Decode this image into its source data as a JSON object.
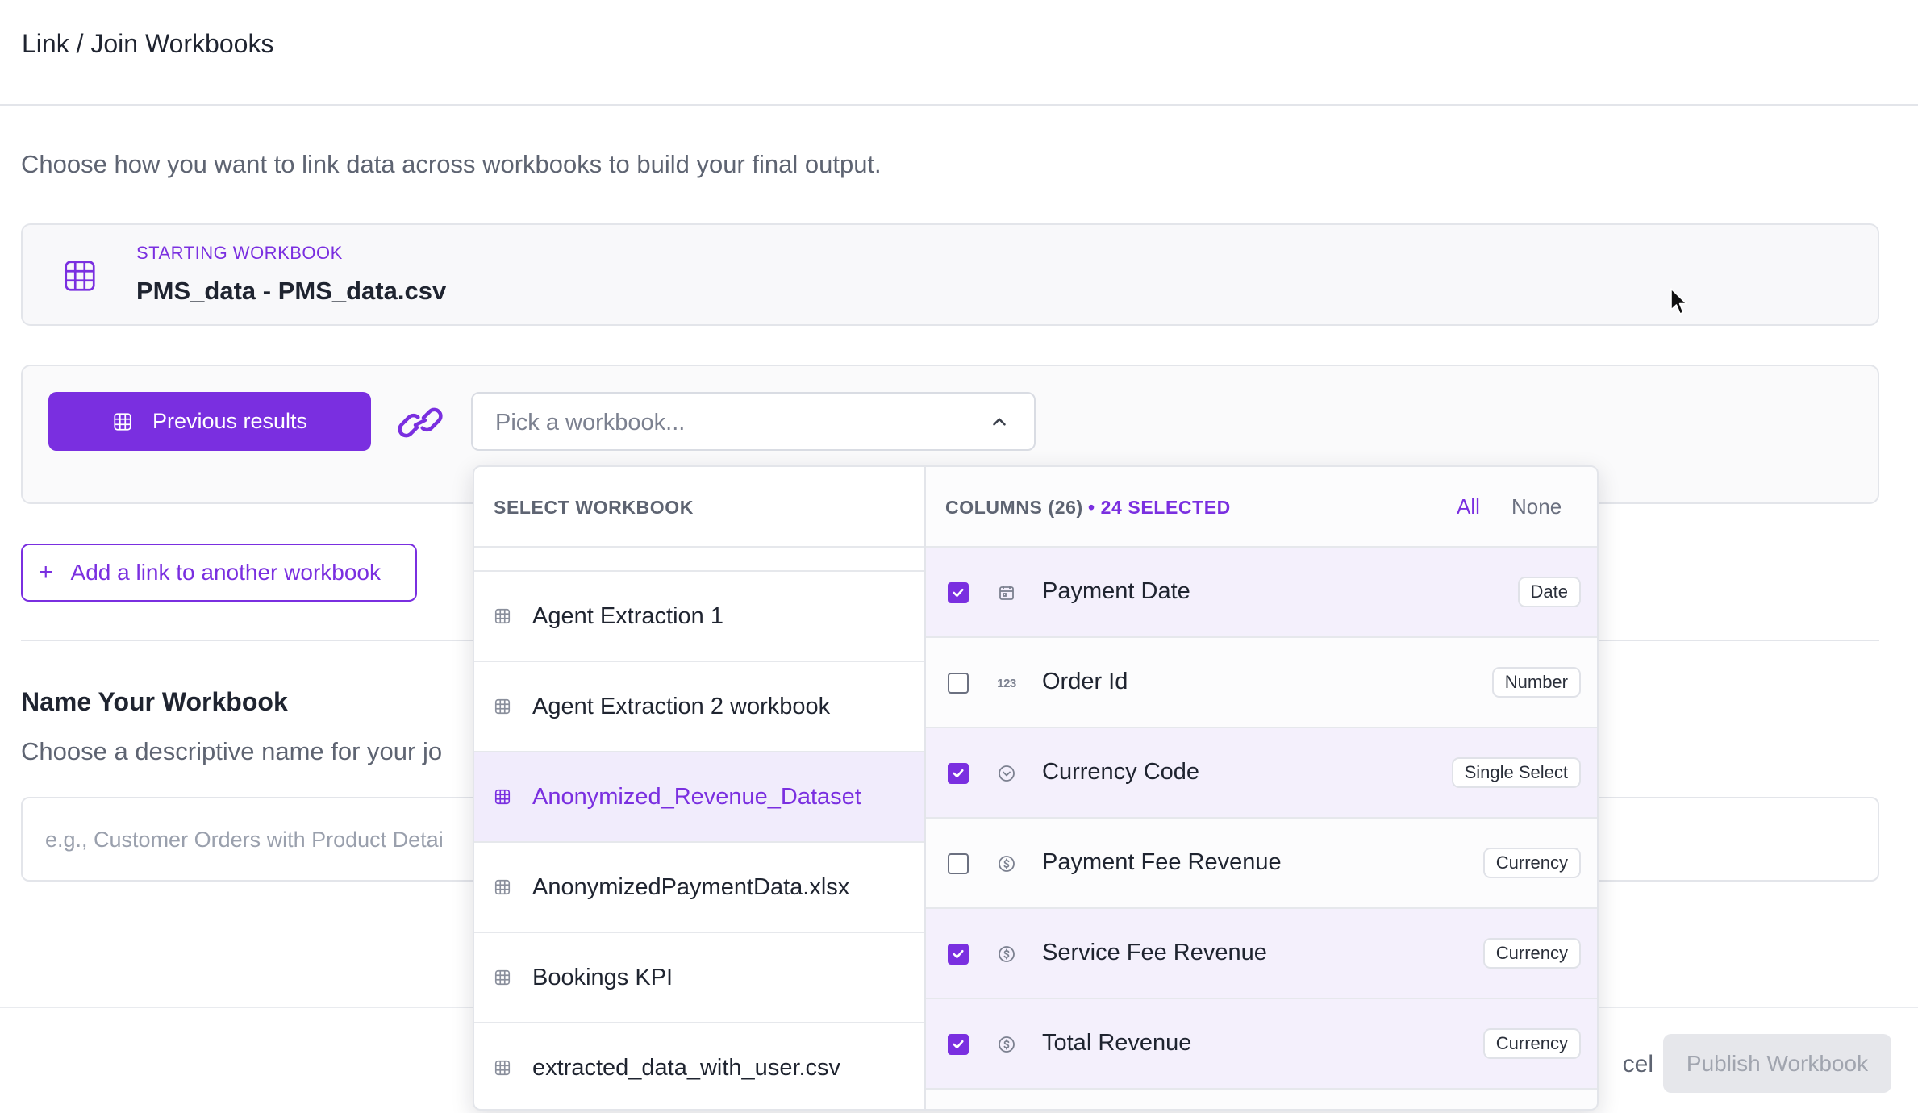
{
  "header": {
    "title": "Link / Join Workbooks"
  },
  "intro": "Choose how you want to link data across workbooks to build your final output.",
  "starting_workbook": {
    "label": "STARTING WORKBOOK",
    "value": "PMS_data - PMS_data.csv",
    "icon": "table-icon"
  },
  "link": {
    "previous_results_label": "Previous results",
    "picker_placeholder": "Pick a workbook...",
    "add_link_label": "Add a link to another workbook"
  },
  "name_section": {
    "title": "Name Your Workbook",
    "description": "Choose a descriptive name for your jo",
    "placeholder": "e.g., Customer Orders with Product Detai"
  },
  "footer": {
    "cancel_label": "cel",
    "publish_label": "Publish Workbook"
  },
  "dropdown": {
    "workbooks_header": "SELECT WORKBOOK",
    "workbooks": [
      {
        "name": "Agent Extraction 1",
        "active": false
      },
      {
        "name": "Agent Extraction 2 workbook",
        "active": false
      },
      {
        "name": "Anonymized_Revenue_Dataset",
        "active": true
      },
      {
        "name": "AnonymizedPaymentData.xlsx",
        "active": false
      },
      {
        "name": "Bookings KPI",
        "active": false
      },
      {
        "name": "extracted_data_with_user.csv",
        "active": false
      }
    ],
    "columns_header": "COLUMNS (26)",
    "selected_count": "• 24 SELECTED",
    "all_label": "All",
    "none_label": "None",
    "columns": [
      {
        "name": "Payment Date",
        "type": "Date",
        "checked": true,
        "icon": "calendar-icon"
      },
      {
        "name": "Order Id",
        "type": "Number",
        "checked": false,
        "icon": "number-icon"
      },
      {
        "name": "Currency Code",
        "type": "Single Select",
        "checked": true,
        "icon": "select-icon"
      },
      {
        "name": "Payment Fee Revenue",
        "type": "Currency",
        "checked": false,
        "icon": "currency-icon"
      },
      {
        "name": "Service Fee Revenue",
        "type": "Currency",
        "checked": true,
        "icon": "currency-icon"
      },
      {
        "name": "Total Revenue",
        "type": "Currency",
        "checked": true,
        "icon": "currency-icon"
      }
    ]
  },
  "colors": {
    "accent": "#7a2fe0",
    "accent_light": "#f1ecfc",
    "border": "#e3e5ea",
    "muted": "#5e6472"
  }
}
